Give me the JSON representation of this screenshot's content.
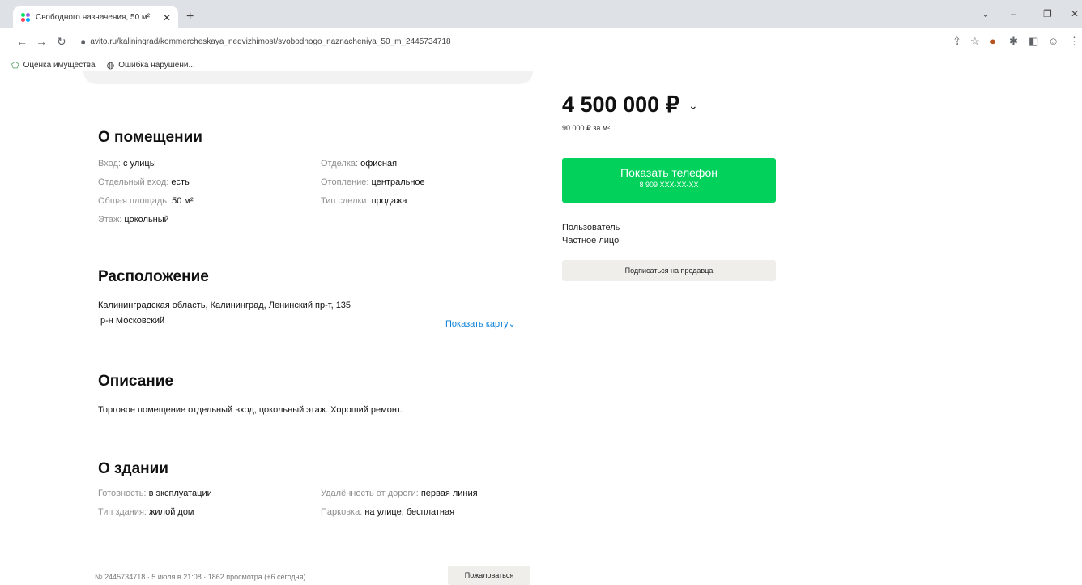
{
  "browser": {
    "tab_title": "Свободного назначения, 50 м²",
    "tab_close": "✕",
    "new_tab": "+",
    "url": "avito.ru/kaliningrad/kommercheskaya_nedvizhimost/svobodnogo_naznacheniya_50_m_2445734718",
    "bookmarks": [
      "Оценка имущества",
      "Ошибка нарушени..."
    ]
  },
  "room": {
    "title": "О помещении",
    "left": [
      {
        "k": "Вход:",
        "v": "с улицы"
      },
      {
        "k": "Отдельный вход:",
        "v": "есть"
      },
      {
        "k": "Общая площадь:",
        "v": "50 м²"
      },
      {
        "k": "Этаж:",
        "v": "цокольный"
      }
    ],
    "right": [
      {
        "k": "Отделка:",
        "v": "офисная"
      },
      {
        "k": "Отопление:",
        "v": "центральное"
      },
      {
        "k": "Тип сделки:",
        "v": "продажа"
      }
    ]
  },
  "location": {
    "title": "Расположение",
    "address": "Калининградская область, Калининград, Ленинский пр-т, 135",
    "district": "р-н Московский",
    "map_link": "Показать карту"
  },
  "description": {
    "title": "Описание",
    "text": "Торговое помещение отдельный вход, цокольный этаж. Хороший ремонт."
  },
  "building": {
    "title": "О здании",
    "left": [
      {
        "k": "Готовность:",
        "v": "в эксплуатации"
      },
      {
        "k": "Тип здания:",
        "v": "жилой дом"
      }
    ],
    "right": [
      {
        "k": "Удалённость от дороги:",
        "v": "первая линия"
      },
      {
        "k": "Парковка:",
        "v": "на улице, бесплатная"
      }
    ]
  },
  "footer": {
    "meta": "№ 2445734718 · 5 июля в 21:08 · 1862 просмотра (+6 сегодня)",
    "report": "Пожаловаться"
  },
  "sidebar": {
    "price": "4 500 000 ₽",
    "per_m2": "90 000 ₽ за м²",
    "phone_button": "Показать телефон",
    "phone_masked": "8 909 XXX-XX-XX",
    "seller_name": "Пользователь",
    "seller_type": "Частное лицо",
    "subscribe": "Подписаться на продавца"
  }
}
